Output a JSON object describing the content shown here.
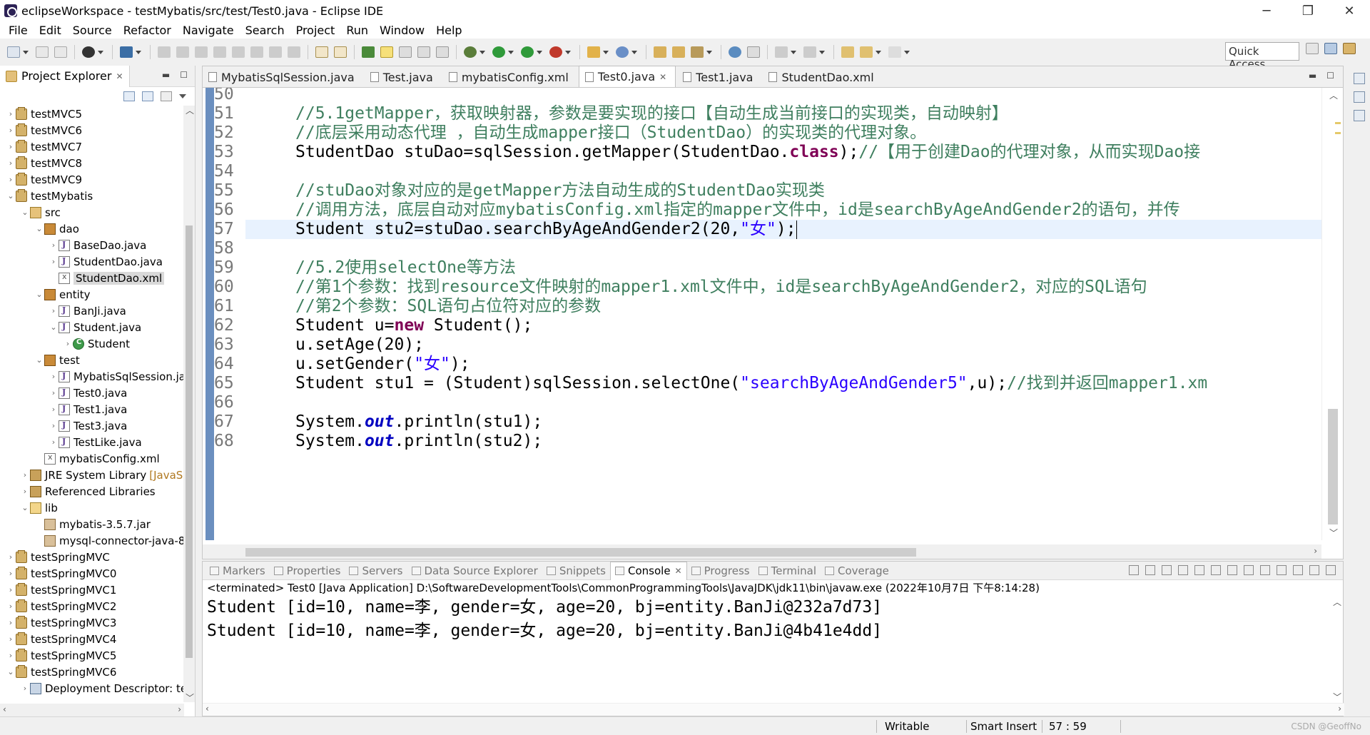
{
  "window": {
    "title": "eclipseWorkspace - testMybatis/src/test/Test0.java - Eclipse IDE",
    "minimize": "─",
    "restore": "❐",
    "close": "✕"
  },
  "menu": [
    "File",
    "Edit",
    "Source",
    "Refactor",
    "Navigate",
    "Search",
    "Project",
    "Run",
    "Window",
    "Help"
  ],
  "toolbar": {
    "quick_access": "Quick Access"
  },
  "project_explorer": {
    "title": "Project Explorer",
    "close": "✕",
    "tree": [
      {
        "label": "testMVC5",
        "arrow": "›",
        "indent": 0,
        "icon": "project"
      },
      {
        "label": "testMVC6",
        "arrow": "›",
        "indent": 0,
        "icon": "project"
      },
      {
        "label": "testMVC7",
        "arrow": "›",
        "indent": 0,
        "icon": "project"
      },
      {
        "label": "testMVC8",
        "arrow": "›",
        "indent": 0,
        "icon": "project"
      },
      {
        "label": "testMVC9",
        "arrow": "›",
        "indent": 0,
        "icon": "project"
      },
      {
        "label": "testMybatis",
        "arrow": "⌄",
        "indent": 0,
        "icon": "project"
      },
      {
        "label": "src",
        "arrow": "⌄",
        "indent": 1,
        "icon": "srcfolder"
      },
      {
        "label": "dao",
        "arrow": "⌄",
        "indent": 2,
        "icon": "package"
      },
      {
        "label": "BaseDao.java",
        "arrow": "›",
        "indent": 3,
        "icon": "java"
      },
      {
        "label": "StudentDao.java",
        "arrow": "›",
        "indent": 3,
        "icon": "java"
      },
      {
        "label": "StudentDao.xml",
        "arrow": "",
        "indent": 3,
        "icon": "xml",
        "selected": true
      },
      {
        "label": "entity",
        "arrow": "⌄",
        "indent": 2,
        "icon": "package"
      },
      {
        "label": "BanJi.java",
        "arrow": "›",
        "indent": 3,
        "icon": "java"
      },
      {
        "label": "Student.java",
        "arrow": "⌄",
        "indent": 3,
        "icon": "java"
      },
      {
        "label": "Student",
        "arrow": "›",
        "indent": 4,
        "icon": "class"
      },
      {
        "label": "test",
        "arrow": "⌄",
        "indent": 2,
        "icon": "package"
      },
      {
        "label": "MybatisSqlSession.ja",
        "arrow": "›",
        "indent": 3,
        "icon": "java"
      },
      {
        "label": "Test0.java",
        "arrow": "›",
        "indent": 3,
        "icon": "java"
      },
      {
        "label": "Test1.java",
        "arrow": "›",
        "indent": 3,
        "icon": "java"
      },
      {
        "label": "Test3.java",
        "arrow": "›",
        "indent": 3,
        "icon": "java"
      },
      {
        "label": "TestLike.java",
        "arrow": "›",
        "indent": 3,
        "icon": "java"
      },
      {
        "label": "mybatisConfig.xml",
        "arrow": "",
        "indent": 2,
        "icon": "xml"
      },
      {
        "label": "JRE System Library",
        "extra": "[JavaSE",
        "arrow": "›",
        "indent": 1,
        "icon": "lib"
      },
      {
        "label": "Referenced Libraries",
        "arrow": "›",
        "indent": 1,
        "icon": "lib"
      },
      {
        "label": "lib",
        "arrow": "⌄",
        "indent": 1,
        "icon": "folder"
      },
      {
        "label": "mybatis-3.5.7.jar",
        "arrow": "",
        "indent": 2,
        "icon": "jar"
      },
      {
        "label": "mysql-connector-java-8",
        "arrow": "",
        "indent": 2,
        "icon": "jar"
      },
      {
        "label": "testSpringMVC",
        "arrow": "›",
        "indent": 0,
        "icon": "project"
      },
      {
        "label": "testSpringMVC0",
        "arrow": "›",
        "indent": 0,
        "icon": "project"
      },
      {
        "label": "testSpringMVC1",
        "arrow": "›",
        "indent": 0,
        "icon": "project"
      },
      {
        "label": "testSpringMVC2",
        "arrow": "›",
        "indent": 0,
        "icon": "project"
      },
      {
        "label": "testSpringMVC3",
        "arrow": "›",
        "indent": 0,
        "icon": "project"
      },
      {
        "label": "testSpringMVC4",
        "arrow": "›",
        "indent": 0,
        "icon": "project"
      },
      {
        "label": "testSpringMVC5",
        "arrow": "›",
        "indent": 0,
        "icon": "project"
      },
      {
        "label": "testSpringMVC6",
        "arrow": "⌄",
        "indent": 0,
        "icon": "project"
      },
      {
        "label": "Deployment Descriptor: te",
        "arrow": "›",
        "indent": 1,
        "icon": "dd"
      }
    ]
  },
  "editor": {
    "tabs": [
      {
        "label": "MybatisSqlSession.java",
        "active": false
      },
      {
        "label": "Test.java",
        "active": false
      },
      {
        "label": "mybatisConfig.xml",
        "active": false
      },
      {
        "label": "Test0.java",
        "active": true,
        "close": "✕"
      },
      {
        "label": "Test1.java",
        "active": false
      },
      {
        "label": "StudentDao.xml",
        "active": false
      }
    ],
    "current_line": 57,
    "lines": [
      {
        "n": "50",
        "parts": []
      },
      {
        "n": "51",
        "parts": [
          {
            "t": "cm",
            "v": "//5.1getMapper，获取映射器，参数是要实现的接口【自动生成当前接口的实现类，自动映射】"
          }
        ]
      },
      {
        "n": "52",
        "parts": [
          {
            "t": "cm",
            "v": "//底层采用动态代理 ，自动生成mapper接口（StudentDao）的实现类的代理对象。"
          }
        ]
      },
      {
        "n": "53",
        "parts": [
          {
            "t": "",
            "v": "StudentDao "
          },
          {
            "t": "var",
            "v": "stuDao"
          },
          {
            "t": "",
            "v": "="
          },
          {
            "t": "var",
            "v": "sqlSession"
          },
          {
            "t": "",
            "v": ".getMapper(StudentDao."
          },
          {
            "t": "kw",
            "v": "class"
          },
          {
            "t": "",
            "v": ");"
          },
          {
            "t": "cm",
            "v": "//【用于创建Dao的代理对象，从而实现Dao接"
          }
        ]
      },
      {
        "n": "54",
        "parts": []
      },
      {
        "n": "55",
        "parts": [
          {
            "t": "cm",
            "v": "//stuDao对象对应的是getMapper方法自动生成的StudentDao实现类"
          }
        ]
      },
      {
        "n": "56",
        "parts": [
          {
            "t": "cm",
            "v": "//调用方法，底层自动对应mybatisConfig.xml指定的mapper文件中，id是searchByAgeAndGender2的语句，并传"
          }
        ]
      },
      {
        "n": "57",
        "parts": [
          {
            "t": "",
            "v": "Student "
          },
          {
            "t": "var",
            "v": "stu2"
          },
          {
            "t": "",
            "v": "="
          },
          {
            "t": "var",
            "v": "stuDao"
          },
          {
            "t": "",
            "v": ".searchByAgeAndGender2(20,"
          },
          {
            "t": "str",
            "v": "\"女\""
          },
          {
            "t": "",
            "v": ");"
          },
          {
            "t": "caret",
            "v": ""
          }
        ]
      },
      {
        "n": "58",
        "parts": []
      },
      {
        "n": "59",
        "parts": [
          {
            "t": "cm",
            "v": "//5.2使用selectOne等方法"
          }
        ]
      },
      {
        "n": "60",
        "parts": [
          {
            "t": "cm",
            "v": "//第1个参数：找到resource文件映射的mapper1.xml文件中，id是searchByAgeAndGender2，对应的SQL语句"
          }
        ]
      },
      {
        "n": "61",
        "parts": [
          {
            "t": "cm",
            "v": "//第2个参数：SQL语句占位符对应的参数"
          }
        ]
      },
      {
        "n": "62",
        "parts": [
          {
            "t": "",
            "v": "Student "
          },
          {
            "t": "var",
            "v": "u"
          },
          {
            "t": "",
            "v": "="
          },
          {
            "t": "kw",
            "v": "new"
          },
          {
            "t": "",
            "v": " Student();"
          }
        ]
      },
      {
        "n": "63",
        "parts": [
          {
            "t": "var",
            "v": "u"
          },
          {
            "t": "",
            "v": ".setAge(20);"
          }
        ]
      },
      {
        "n": "64",
        "parts": [
          {
            "t": "var",
            "v": "u"
          },
          {
            "t": "",
            "v": ".setGender("
          },
          {
            "t": "str",
            "v": "\"女\""
          },
          {
            "t": "",
            "v": ");"
          }
        ]
      },
      {
        "n": "65",
        "parts": [
          {
            "t": "",
            "v": "Student "
          },
          {
            "t": "var",
            "v": "stu1"
          },
          {
            "t": "",
            "v": " = (Student)"
          },
          {
            "t": "var",
            "v": "sqlSession"
          },
          {
            "t": "",
            "v": ".selectOne("
          },
          {
            "t": "str",
            "v": "\"searchByAgeAndGender5\""
          },
          {
            "t": "",
            "v": ","
          },
          {
            "t": "var",
            "v": "u"
          },
          {
            "t": "",
            "v": ");"
          },
          {
            "t": "cm",
            "v": "//找到并返回mapper1.xm"
          }
        ]
      },
      {
        "n": "66",
        "parts": []
      },
      {
        "n": "67",
        "parts": [
          {
            "t": "",
            "v": "System."
          },
          {
            "t": "fld",
            "v": "out"
          },
          {
            "t": "",
            "v": ".println("
          },
          {
            "t": "var",
            "v": "stu1"
          },
          {
            "t": "",
            "v": ");"
          }
        ]
      },
      {
        "n": "68",
        "parts": [
          {
            "t": "",
            "v": "System."
          },
          {
            "t": "fld",
            "v": "out"
          },
          {
            "t": "",
            "v": ".println("
          },
          {
            "t": "var",
            "v": "stu2"
          },
          {
            "t": "",
            "v": ");"
          }
        ]
      }
    ]
  },
  "bottom_panel": {
    "tabs": [
      {
        "label": "Markers",
        "active": false
      },
      {
        "label": "Properties",
        "active": false
      },
      {
        "label": "Servers",
        "active": false
      },
      {
        "label": "Data Source Explorer",
        "active": false
      },
      {
        "label": "Snippets",
        "active": false
      },
      {
        "label": "Console",
        "active": true,
        "close": "✕"
      },
      {
        "label": "Progress",
        "active": false
      },
      {
        "label": "Terminal",
        "active": false
      },
      {
        "label": "Coverage",
        "active": false
      }
    ],
    "console_status": "<terminated> Test0 [Java Application] D:\\SoftwareDevelopmentTools\\CommonProgrammingTools\\JavaJDK\\jdk11\\bin\\javaw.exe (2022年10月7日 下午8:14:28)",
    "output": [
      "Student [id=10, name=李, gender=女, age=20, bj=entity.BanJi@232a7d73]",
      "Student [id=10, name=李, gender=女, age=20, bj=entity.BanJi@4b41e4dd]"
    ]
  },
  "status_bar": {
    "writable": "Writable",
    "insert_mode": "Smart Insert",
    "position": "57 : 59",
    "watermark": "CSDN @GeoffNo"
  },
  "colors": {
    "comment": "#3f7f5f",
    "keyword": "#7f0055",
    "string": "#2a00ff",
    "field": "#0000c0",
    "current_line": "#e8f2fe",
    "gutter_marker": "#6b8fbf"
  }
}
